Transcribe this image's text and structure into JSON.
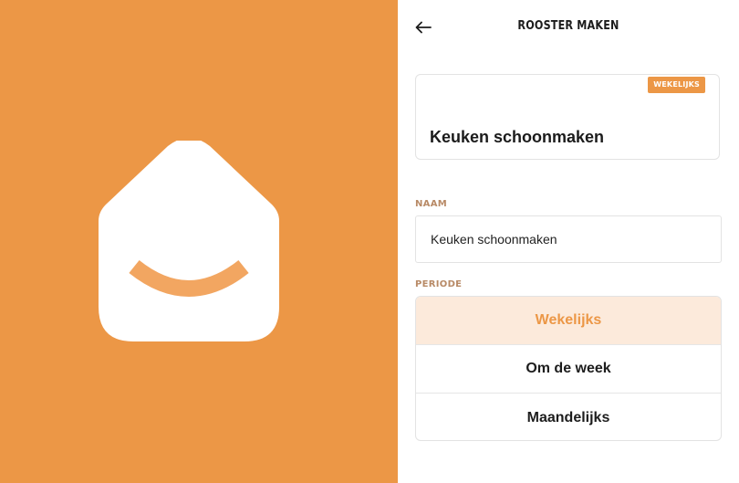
{
  "colors": {
    "accent": "#EC9746",
    "selected_bg": "#FCEADB",
    "label": "#B88A66"
  },
  "header": {
    "title": "ROOSTER MAKEN",
    "back_icon": "arrow-left-icon"
  },
  "preview": {
    "badge": "WEKELIJKS",
    "title": "Keuken schoonmaken"
  },
  "form": {
    "name_label": "NAAM",
    "name_value": "Keuken schoonmaken",
    "period_label": "PERIODE",
    "period_options": [
      "Wekelijks",
      "Om de week",
      "Maandelijks"
    ],
    "selected_period": "Wekelijks"
  },
  "brand": {
    "logo_icon": "house-smile-logo"
  }
}
